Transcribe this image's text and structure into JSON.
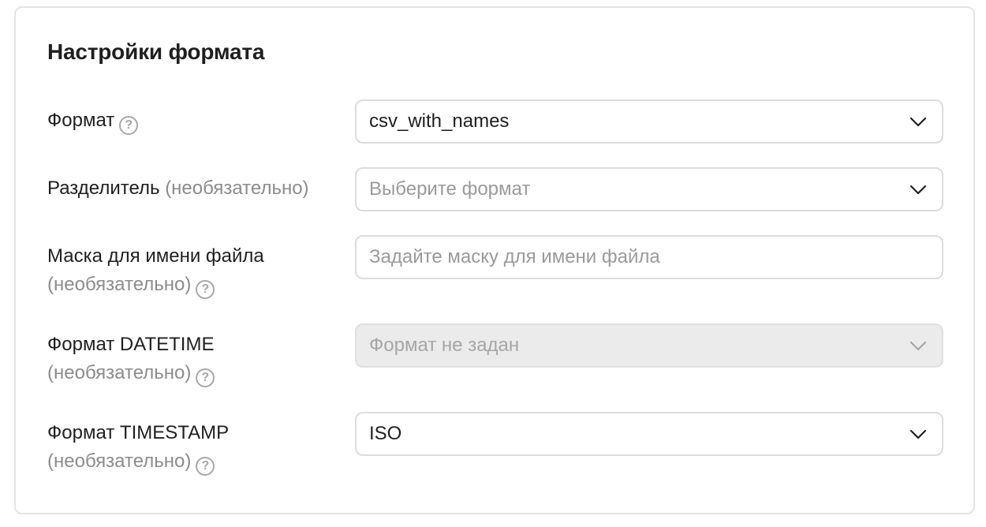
{
  "card": {
    "title": "Настройки формата"
  },
  "rows": [
    {
      "label": "Формат",
      "has_help": true,
      "control": "select",
      "value": "csv_with_names"
    },
    {
      "label": "Разделитель",
      "optional": "(необязательно)",
      "control": "select",
      "placeholder": "Выберите формат"
    },
    {
      "label": "Маска для имени файла",
      "optional": "(необязательно)",
      "has_help": true,
      "control": "input",
      "placeholder": "Задайте маску для имени файла"
    },
    {
      "label": "Формат DATETIME",
      "optional": "(необязательно)",
      "has_help": true,
      "control": "select",
      "disabled": true,
      "placeholder": "Формат не задан"
    },
    {
      "label": "Формат TIMESTAMP",
      "optional": "(необязательно)",
      "has_help": true,
      "control": "select",
      "value": "ISO"
    }
  ],
  "help_glyph": "?",
  "icons": {
    "help": "question-circle-icon",
    "dropdown": "chevron-down-icon"
  },
  "colors": {
    "text": "#1f1f1f",
    "muted": "#8c8c8c",
    "border": "#dcdcdc",
    "disabled_bg": "#ebebeb"
  }
}
